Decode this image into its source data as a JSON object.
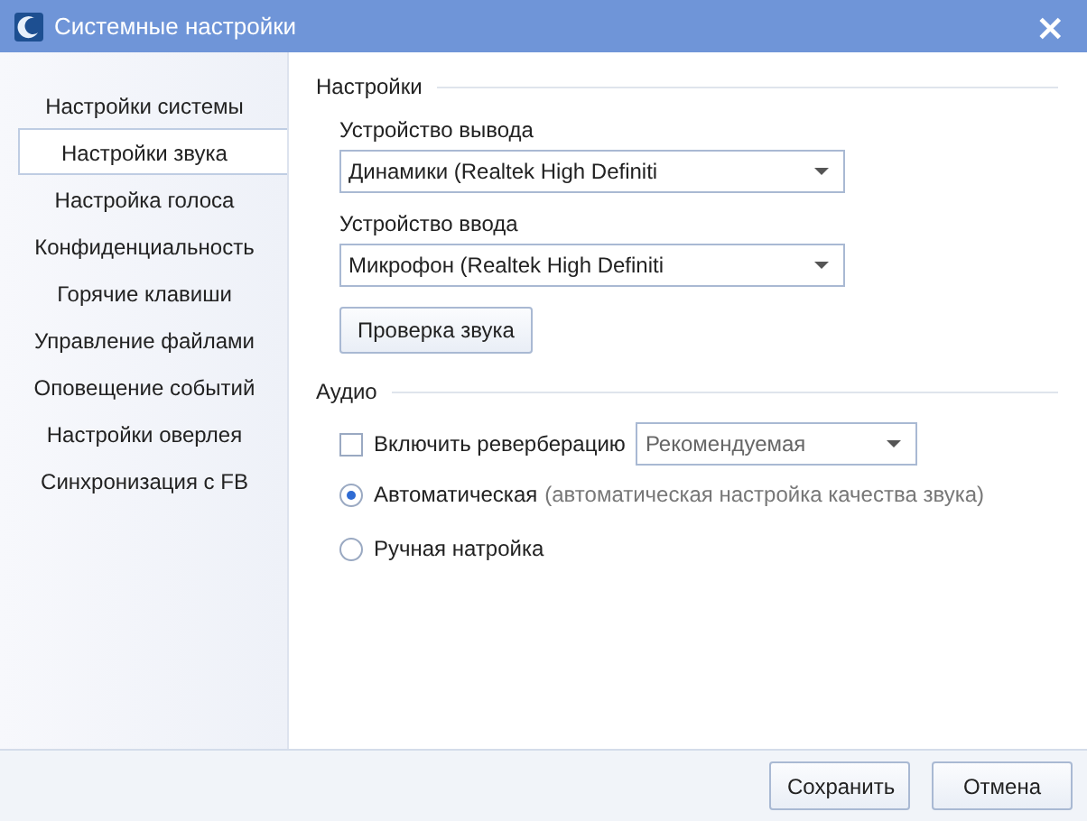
{
  "window": {
    "title": "Системные настройки",
    "close": "×"
  },
  "sidebar": {
    "items": [
      {
        "label": "Настройки системы",
        "selected": false
      },
      {
        "label": "Настройки звука",
        "selected": true
      },
      {
        "label": "Настройка голоса",
        "selected": false
      },
      {
        "label": "Конфиденциальность",
        "selected": false
      },
      {
        "label": "Горячие клавиши",
        "selected": false
      },
      {
        "label": "Управление файлами",
        "selected": false
      },
      {
        "label": "Оповещение событий",
        "selected": false
      },
      {
        "label": "Настройки оверлея",
        "selected": false
      },
      {
        "label": "Синхронизация с FB",
        "selected": false
      }
    ]
  },
  "settings": {
    "heading": "Настройки",
    "output_label": "Устройство вывода",
    "output_value": "Динамики (Realtek High Definiti",
    "input_label": "Устройство ввода",
    "input_value": "Микрофон (Realtek High Definiti",
    "test_button": "Проверка звука"
  },
  "audio": {
    "heading": "Аудио",
    "reverb": {
      "label": "Включить реверберацию",
      "checked": false,
      "value": "Рекомендуемая"
    },
    "modes": [
      {
        "label": "Автоматическая",
        "note": "(автоматическая настройка качества звука)",
        "selected": true
      },
      {
        "label": "Ручная натройка",
        "selected": false
      }
    ]
  },
  "buttons": [
    "Сохранить",
    "Отмена"
  ]
}
